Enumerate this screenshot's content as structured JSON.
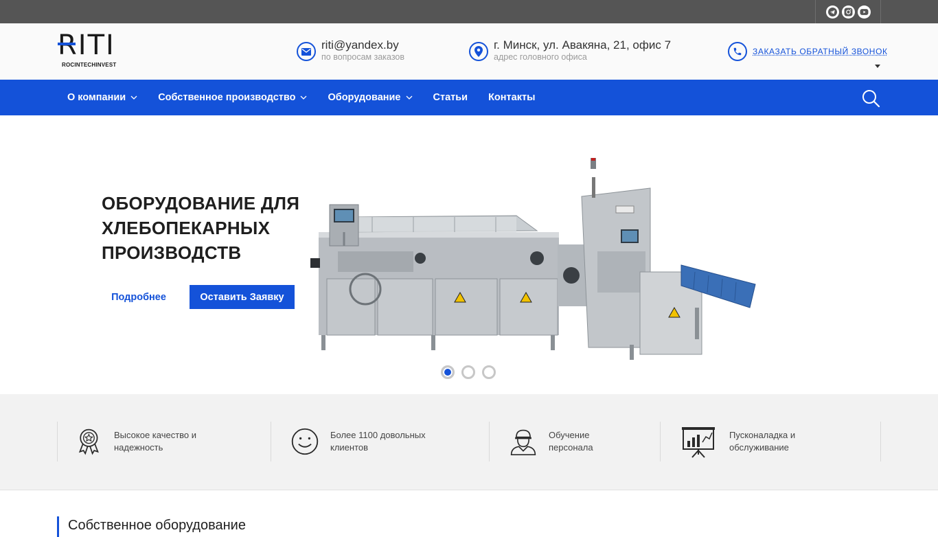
{
  "topbar": {
    "social": [
      {
        "icon": "telegram-icon"
      },
      {
        "icon": "instagram-icon"
      },
      {
        "icon": "youtube-icon"
      }
    ]
  },
  "header": {
    "logo": {
      "word": "RITI",
      "subtitle": "ROCINTECHINVEST"
    },
    "email": {
      "value": "riti@yandex.by",
      "caption": "по вопросам заказов",
      "icon": "mail-icon"
    },
    "address": {
      "value": "г. Минск, ул. Авакяна, 21, офис 7",
      "caption": "адрес головного офиса",
      "icon": "map-pin-icon"
    },
    "callback": {
      "label": "ЗАКАЗАТЬ ОБРАТНЫЙ ЗВОНОК",
      "icon": "phone-icon"
    }
  },
  "nav": {
    "items": [
      {
        "label": "О компании",
        "dropdown": true
      },
      {
        "label": "Собственное производство",
        "dropdown": true
      },
      {
        "label": "Оборудование",
        "dropdown": true
      },
      {
        "label": "Статьи",
        "dropdown": false
      },
      {
        "label": "Контакты",
        "dropdown": false
      }
    ],
    "search_icon": "search-icon"
  },
  "hero": {
    "title": "ОБОРУДОВАНИЕ ДЛЯ ХЛЕБОПЕКАРНЫХ ПРОИЗВОДСТВ",
    "more_label": "Подробнее",
    "order_label": "Оставить Заявку",
    "slides": {
      "count": 3,
      "active": 1
    }
  },
  "features": [
    {
      "text": "Высокое качество и надежность",
      "icon": "award-badge-icon"
    },
    {
      "text": "Более 1100 довольных клиентов",
      "icon": "smiley-icon"
    },
    {
      "text": "Обучение персонала",
      "icon": "worker-helmet-icon"
    },
    {
      "text": "Пусконаладка и обслуживание",
      "icon": "presentation-chart-icon"
    }
  ],
  "section": {
    "title": "Собственное оборудование"
  },
  "colors": {
    "brand_blue": "#1452d9",
    "topbar": "#555555",
    "features_bg": "#f2f2f2"
  }
}
